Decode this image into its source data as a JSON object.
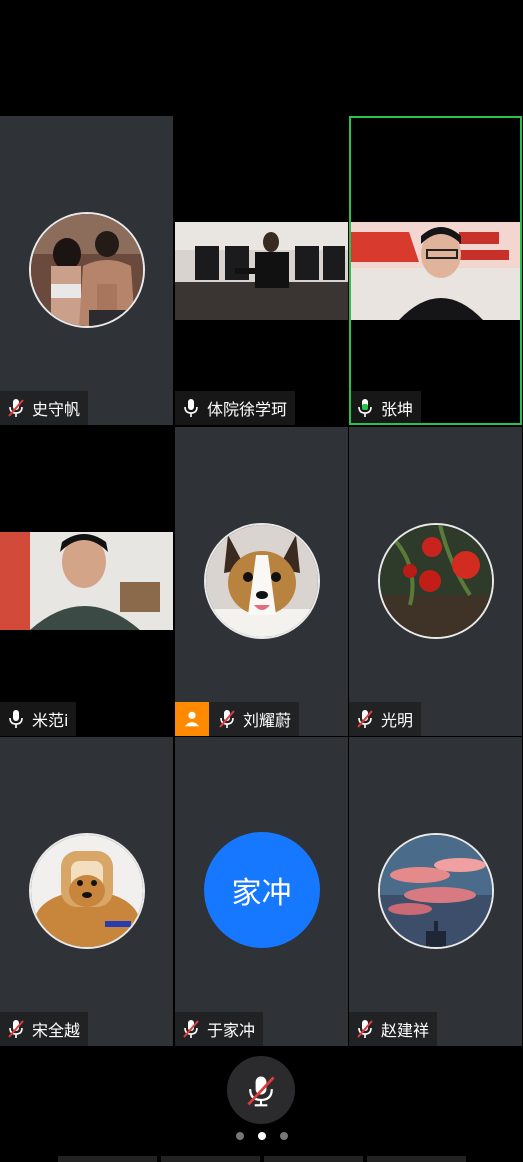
{
  "participants": [
    {
      "name": "史守帆",
      "mic": "muted",
      "kind": "avatar",
      "avatar_icon": "fitness-selfie-avatar"
    },
    {
      "name": "体院徐学珂",
      "mic": "on",
      "kind": "video"
    },
    {
      "name": "张坤",
      "mic": "speaking",
      "kind": "video",
      "speaking": true
    },
    {
      "name": "米范i",
      "mic": "on",
      "kind": "video"
    },
    {
      "name": "刘耀蔚",
      "mic": "muted",
      "kind": "avatar",
      "host": true,
      "avatar_icon": "corgi-dog-avatar"
    },
    {
      "name": "光明",
      "mic": "muted",
      "kind": "avatar",
      "avatar_icon": "tomato-plant-avatar"
    },
    {
      "name": "宋全越",
      "mic": "muted",
      "kind": "avatar",
      "avatar_icon": "bread-dog-avatar"
    },
    {
      "name": "于家冲",
      "mic": "muted",
      "kind": "text-avatar",
      "avatar_text": "家冲"
    },
    {
      "name": "赵建祥",
      "mic": "muted",
      "kind": "avatar",
      "avatar_icon": "sunset-sky-avatar"
    }
  ],
  "colors": {
    "tile_bg": "#2f3236",
    "speaking_border": "#27c24c",
    "host_badge": "#ff8a00",
    "text_avatar_bg": "#1677ff",
    "muted_slash": "#e03c3c"
  },
  "controls": {
    "mic_button_icon": "mic-muted-icon",
    "page_count": 3,
    "active_page": 2
  }
}
